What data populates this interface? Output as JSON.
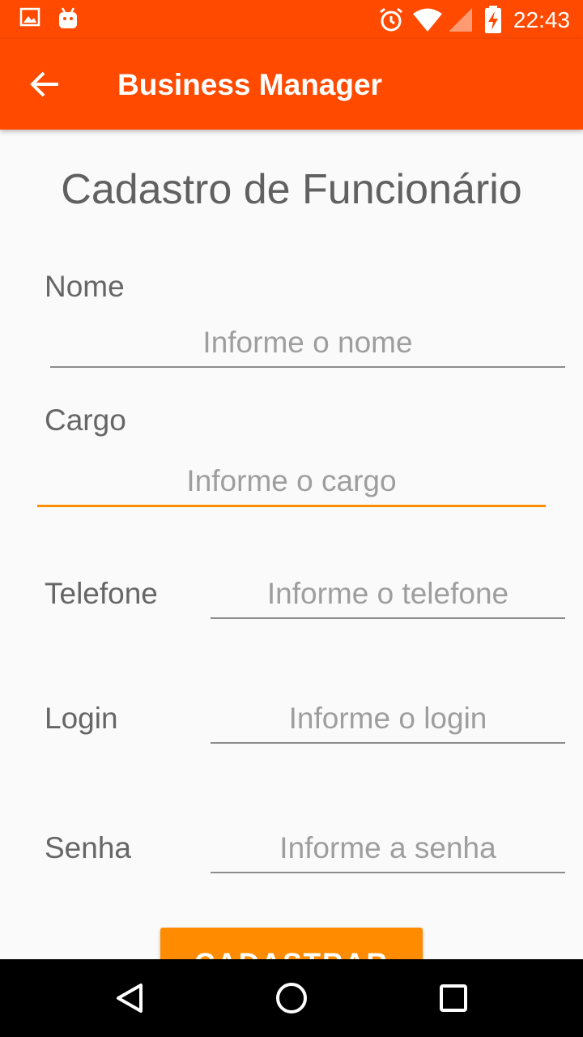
{
  "status_bar": {
    "time": "22:43",
    "left_icons": [
      "image-notification-icon",
      "android-notification-icon"
    ],
    "right_icons": [
      "alarm-icon",
      "wifi-icon",
      "signal-icon",
      "battery-charging-icon"
    ]
  },
  "app_bar": {
    "title": "Business Manager",
    "background_color": "#ff4a00",
    "back_icon": "arrow-back-icon"
  },
  "form": {
    "title": "Cadastro de Funcionário",
    "fields": {
      "nome": {
        "label": "Nome",
        "value": "",
        "placeholder": "Informe o nome"
      },
      "cargo": {
        "label": "Cargo",
        "value": "",
        "placeholder": "Informe o cargo",
        "focused": true
      },
      "telefone": {
        "label": "Telefone",
        "value": "",
        "placeholder": "Informe o telefone"
      },
      "login": {
        "label": "Login",
        "value": "",
        "placeholder": "Informe o login"
      },
      "senha": {
        "label": "Senha",
        "value": "",
        "placeholder": "Informe a senha"
      }
    },
    "accent_color": "#ff8f00",
    "submit_label": "CADASTRAR",
    "submit_color": "#ff8c00"
  },
  "nav_bar": {
    "buttons": [
      "back-triangle-icon",
      "home-circle-icon",
      "recents-square-icon"
    ]
  }
}
